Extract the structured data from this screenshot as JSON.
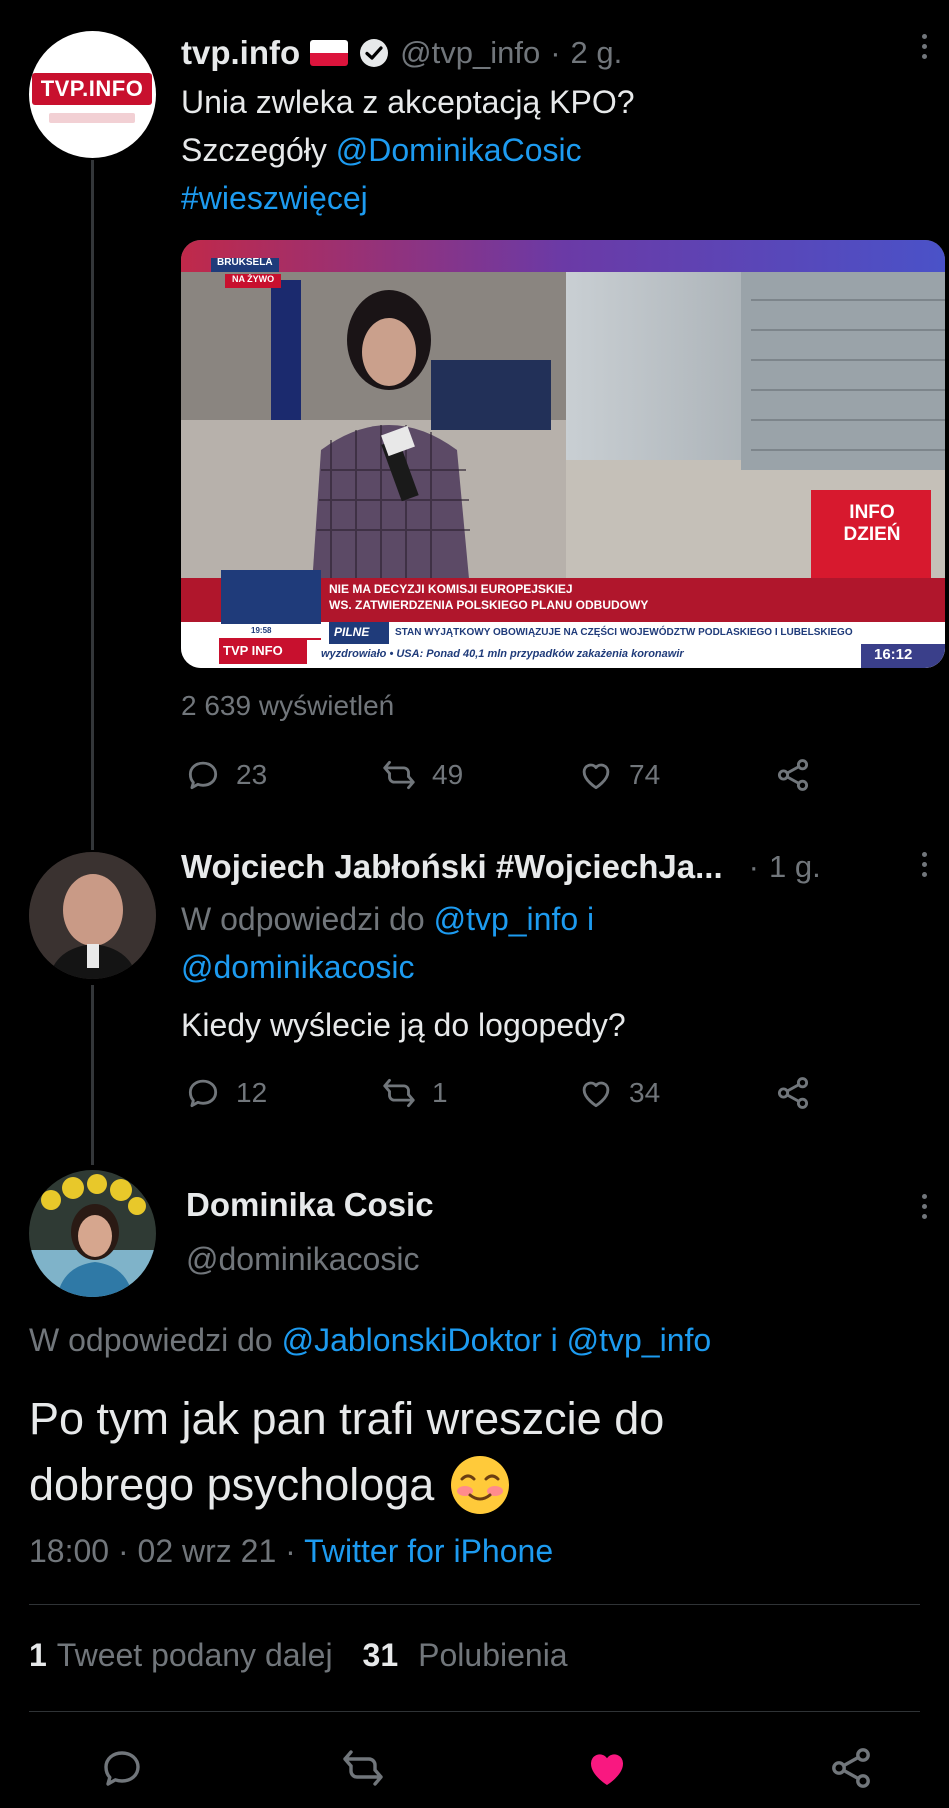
{
  "tweet1": {
    "name": "tvp.info",
    "handle": "@tvp_info",
    "sep": "·",
    "time": "2 g.",
    "line1": "Unia zwleka z akceptacją KPO?",
    "line2_prefix": "Szczegóły",
    "mention": "@DominikaCosic",
    "hashtag": "#wieszwięcej",
    "views": "2 639 wyświetleń",
    "replies": "23",
    "retweets": "49",
    "likes": "74",
    "avatar_logo": "TVP.INFO",
    "media": {
      "location": "BRUKSELA",
      "live": "NA ŻYWO",
      "headline1": "NIE MA DECYZJI KOMISJI EUROPEJSKIEJ",
      "headline2": "WS. ZATWIERDZENIA POLSKIEGO PLANU ODBUDOWY",
      "urgent_label": "PILNE",
      "urgent_text": "STAN WYJĄTKOWY OBOWIĄZUJE NA CZĘŚCI WOJEWÓDZTW PODLASKIEGO I LUBELSKIEGO",
      "ticker": "wyzdrowiało • USA: Ponad 40,1 mln przypadków zakażenia koronawir",
      "clock": "16:12",
      "time_small": "19:58",
      "channel": "TVP INFO",
      "badge_line1": "INFO",
      "badge_line2": "DZIEŃ"
    }
  },
  "tweet2": {
    "name": "Wojciech Jabłoński #WojciechJa...",
    "sep": "·",
    "time": "1 g.",
    "reply_prefix": "W odpowiedzi do",
    "reply_to1": "@tvp_info i",
    "reply_to2": "@dominikacosic",
    "text": "Kiedy wyślecie ją do logopedy?",
    "replies": "12",
    "retweets": "1",
    "likes": "34"
  },
  "tweet3": {
    "name": "Dominika Cosic",
    "handle": "@dominikacosic",
    "reply_prefix": "W odpowiedzi do",
    "reply_to": "@JablonskiDoktor i @tvp_info",
    "text_line1": "Po tym jak pan trafi wreszcie do",
    "text_line2": "dobrego psychologa",
    "emoji": "☺",
    "timestamp": "18:00 · 02 wrz 21 ·",
    "source": "Twitter for iPhone",
    "retweet_count": "1",
    "retweet_label": "Tweet podany dalej",
    "like_count": "31",
    "like_label": "Polubienia"
  },
  "colors": {
    "accent": "#1d9bf0",
    "like_active": "#f91880",
    "muted": "#71767b",
    "tvp_red": "#c8102e"
  },
  "icons": [
    "reply-icon",
    "retweet-icon",
    "like-icon",
    "share-icon",
    "verified-icon",
    "poland-flag-icon",
    "more-icon"
  ]
}
